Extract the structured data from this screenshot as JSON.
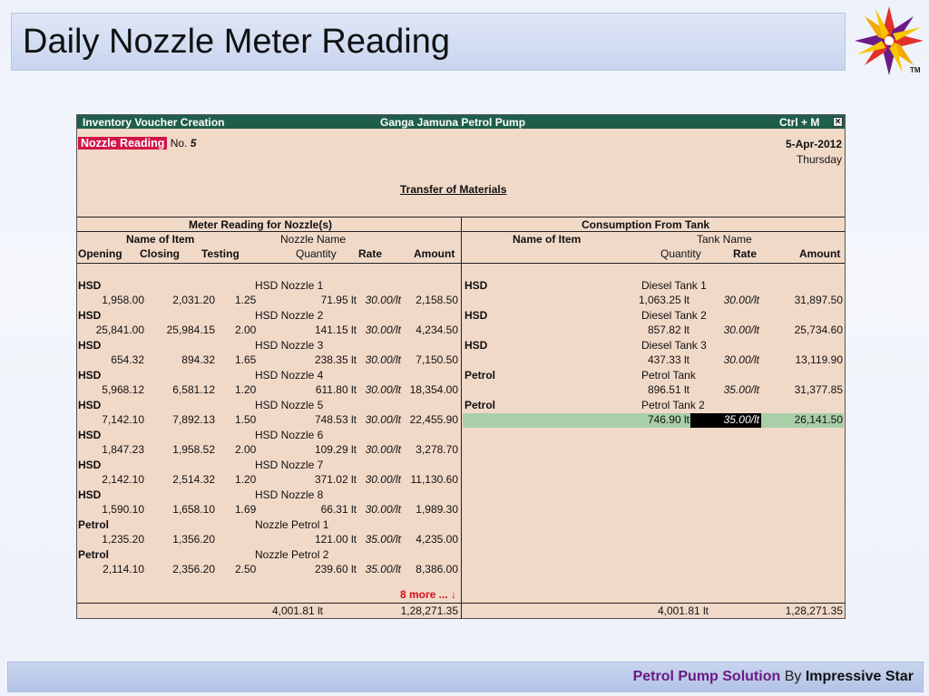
{
  "slide": {
    "title": "Daily Nozzle Meter Reading",
    "tm": "TM",
    "footer": {
      "part1": "Petrol Pump Solution",
      "part2": " By ",
      "part3": "Impressive Star"
    }
  },
  "window": {
    "title": "Inventory Voucher  Creation",
    "company": "Ganga Jamuna Petrol Pump",
    "shortcut": "Ctrl + M",
    "close_glyph": "×"
  },
  "voucher": {
    "type": "Nozzle Reading",
    "no_label": "No.",
    "no_value": "5",
    "date": "5-Apr-2012",
    "day": "Thursday",
    "narration_title": "Transfer of Materials"
  },
  "left": {
    "section_title": "Meter Reading for Nozzle(s)",
    "h_name_of_item": "Name of Item",
    "h_nozzle_name": "Nozzle Name",
    "h_opening": "Opening",
    "h_closing": "Closing",
    "h_testing": "Testing",
    "h_quantity": "Quantity",
    "h_rate": "Rate",
    "h_amount": "Amount",
    "rows": [
      {
        "item": "HSD",
        "nozzle": "HSD Nozzle 1",
        "opening": "1,958.00",
        "closing": "2,031.20",
        "testing": "1.25",
        "qty": "71.95 lt",
        "rate": "30.00/lt",
        "amount": "2,158.50"
      },
      {
        "item": "HSD",
        "nozzle": "HSD Nozzle 2",
        "opening": "25,841.00",
        "closing": "25,984.15",
        "testing": "2.00",
        "qty": "141.15 lt",
        "rate": "30.00/lt",
        "amount": "4,234.50"
      },
      {
        "item": "HSD",
        "nozzle": "HSD Nozzle 3",
        "opening": "654.32",
        "closing": "894.32",
        "testing": "1.65",
        "qty": "238.35 lt",
        "rate": "30.00/lt",
        "amount": "7,150.50"
      },
      {
        "item": "HSD",
        "nozzle": "HSD Nozzle 4",
        "opening": "5,968.12",
        "closing": "6,581.12",
        "testing": "1.20",
        "qty": "611.80 lt",
        "rate": "30.00/lt",
        "amount": "18,354.00"
      },
      {
        "item": "HSD",
        "nozzle": "HSD Nozzle 5",
        "opening": "7,142.10",
        "closing": "7,892.13",
        "testing": "1.50",
        "qty": "748.53 lt",
        "rate": "30.00/lt",
        "amount": "22,455.90"
      },
      {
        "item": "HSD",
        "nozzle": "HSD Nozzle 6",
        "opening": "1,847.23",
        "closing": "1,958.52",
        "testing": "2.00",
        "qty": "109.29 lt",
        "rate": "30.00/lt",
        "amount": "3,278.70"
      },
      {
        "item": "HSD",
        "nozzle": "HSD Nozzle 7",
        "opening": "2,142.10",
        "closing": "2,514.32",
        "testing": "1.20",
        "qty": "371.02 lt",
        "rate": "30.00/lt",
        "amount": "11,130.60"
      },
      {
        "item": "HSD",
        "nozzle": "HSD Nozzle 8",
        "opening": "1,590.10",
        "closing": "1,658.10",
        "testing": "1.69",
        "qty": "66.31 lt",
        "rate": "30.00/lt",
        "amount": "1,989.30"
      },
      {
        "item": "Petrol",
        "nozzle": "Nozzle Petrol 1",
        "opening": "1,235.20",
        "closing": "1,356.20",
        "testing": "",
        "qty": "121.00 lt",
        "rate": "35.00/lt",
        "amount": "4,235.00"
      },
      {
        "item": "Petrol",
        "nozzle": "Nozzle Petrol 2",
        "opening": "2,114.10",
        "closing": "2,356.20",
        "testing": "2.50",
        "qty": "239.60 lt",
        "rate": "35.00/lt",
        "amount": "8,386.00"
      }
    ],
    "more": "8 more ... ↓",
    "total_qty": "4,001.81 lt",
    "total_amount": "1,28,271.35"
  },
  "right": {
    "section_title": "Consumption From Tank",
    "h_name_of_item": "Name of Item",
    "h_tank_name": "Tank Name",
    "h_quantity": "Quantity",
    "h_rate": "Rate",
    "h_amount": "Amount",
    "rows": [
      {
        "item": "HSD",
        "tank": "Diesel Tank 1",
        "qty": "1,063.25 lt",
        "rate": "30.00/lt",
        "amount": "31,897.50"
      },
      {
        "item": "HSD",
        "tank": "Diesel Tank 2",
        "qty": "857.82 lt",
        "rate": "30.00/lt",
        "amount": "25,734.60"
      },
      {
        "item": "HSD",
        "tank": "Diesel Tank 3",
        "qty": "437.33 lt",
        "rate": "30.00/lt",
        "amount": "13,119.90"
      },
      {
        "item": "Petrol",
        "tank": "Petrol Tank",
        "qty": "896.51 lt",
        "rate": "35.00/lt",
        "amount": "31,377.85"
      },
      {
        "item": "Petrol",
        "tank": "Petrol Tank 2",
        "qty": "746.90 lt",
        "rate": "35.00/lt",
        "amount": "26,141.50"
      }
    ],
    "total_qty": "4,001.81 lt",
    "total_amount": "1,28,271.35"
  },
  "colors": {
    "window_header": "#1f5e4b",
    "form_bg": "#f1d9c8",
    "badge": "#d0154b",
    "highlight_row": "#a9cfa8",
    "footer_brand": "#6b1a86"
  }
}
